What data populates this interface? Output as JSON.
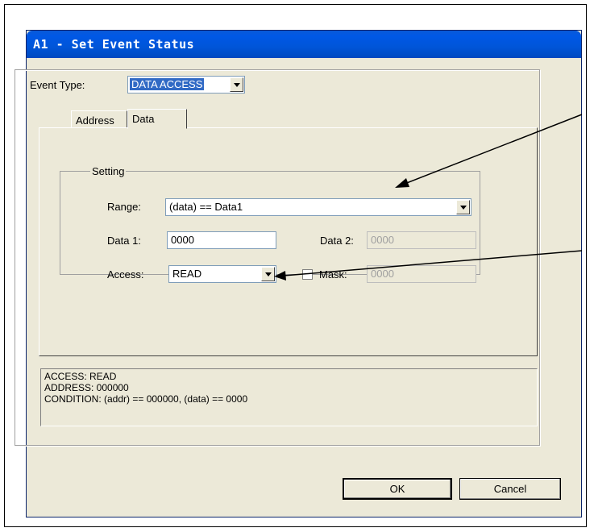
{
  "dialog": {
    "title": "A1 - Set Event Status",
    "event_type_label": "Event Type:",
    "event_type_value": "DATA ACCESS"
  },
  "tabs": [
    {
      "label": "Address"
    },
    {
      "label": "Data"
    }
  ],
  "setting": {
    "group_label": "Setting",
    "range_label": "Range:",
    "range_value": "(data) == Data1",
    "data1_label": "Data 1:",
    "data1_value": "0000",
    "data2_label": "Data 2:",
    "data2_value": "0000",
    "access_label": "Access:",
    "access_value": "READ",
    "mask_label": "Mask:",
    "mask_value": "0000"
  },
  "summary": {
    "line1": "ACCESS: READ",
    "line2": "ADDRESS: 000000",
    "line3": "CONDITION: (addr) == 000000, (data) == 0000"
  },
  "buttons": {
    "ok": "OK",
    "cancel": "Cancel"
  }
}
